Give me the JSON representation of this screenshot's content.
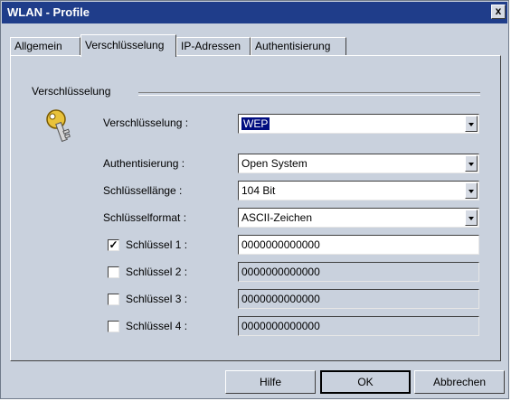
{
  "window": {
    "title": "WLAN - Profile",
    "close_glyph": "x"
  },
  "tabs": [
    "Allgemein",
    "Verschlüsselung",
    "IP-Adressen",
    "Authentisierung"
  ],
  "active_tab": "Verschlüsselung",
  "group_title": "Verschlüsselung",
  "encryption": {
    "label": "Verschlüsselung :",
    "value": "WEP"
  },
  "authentication": {
    "label": "Authentisierung :",
    "value": "Open System"
  },
  "key_length": {
    "label": "Schlüssellänge :",
    "value": "104 Bit"
  },
  "key_format": {
    "label": "Schlüsselformat :",
    "value": "ASCII-Zeichen"
  },
  "keys": [
    {
      "label": "Schlüssel 1 :",
      "value": "0000000000000",
      "checked": true,
      "enabled": true
    },
    {
      "label": "Schlüssel 2 :",
      "value": "0000000000000",
      "checked": false,
      "enabled": false
    },
    {
      "label": "Schlüssel 3 :",
      "value": "0000000000000",
      "checked": false,
      "enabled": false
    },
    {
      "label": "Schlüssel 4 :",
      "value": "0000000000000",
      "checked": false,
      "enabled": false
    }
  ],
  "buttons": {
    "help": "Hilfe",
    "ok": "OK",
    "cancel": "Abbrechen"
  },
  "icons": {
    "key": "key-icon"
  }
}
